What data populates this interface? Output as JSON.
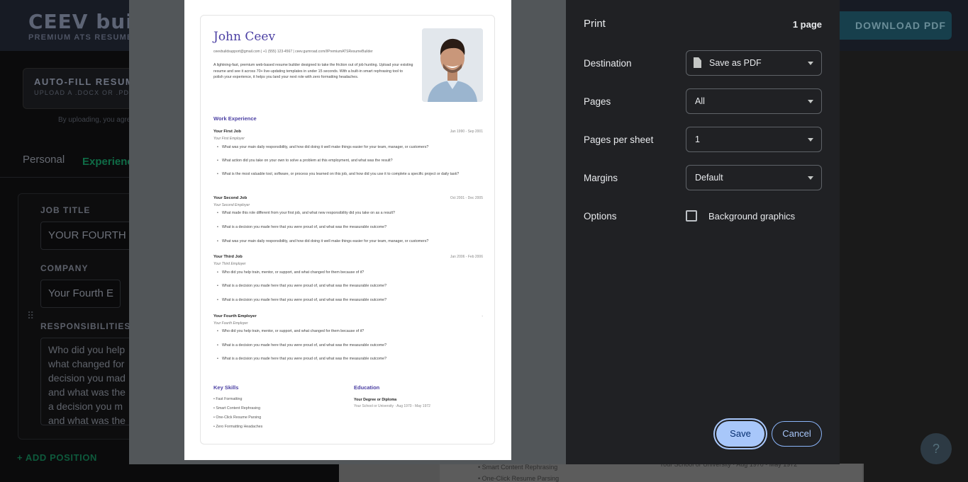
{
  "background_app": {
    "brand": "CEEV build",
    "brand_sub": "PREMIUM ATS RESUME",
    "download_button": "DOWNLOAD PDF",
    "autofill_title": "AUTO-FILL RESUME",
    "autofill_sub": "UPLOAD A .DOCX OR .PDF F",
    "consent_text": "By uploading, you agre",
    "tab_personal": "Personal",
    "tab_experience": "Experienc",
    "job_title_label": "JOB TITLE",
    "job_title_value": "YOUR FOURTH E",
    "company_label": "COMPANY",
    "company_value": "Your Fourth E",
    "responsibilities_label": "RESPONSIBILITIES",
    "responsibilities_value": "Who did you help what changed for decision you mad and what was the a decision you m and what was the",
    "add_position": "+ ADD POSITION",
    "behind_line1": "• Smart Content Rephrasing",
    "behind_line2": "• One-Click Resume Parsing",
    "behind_line3": "Your School or University · Aug 1970 - May 1972",
    "help_icon": "?"
  },
  "resume": {
    "name": "John Ceev",
    "contact": "ceevbuildsupport@gmail.com | +1 (555) 123-4567 | ceev.gumroad.com/l/PremiumATSResumeBuilder",
    "summary": "A lightning-fast, premium web-based resume builder designed to take the friction out of job hunting. Upload your existing resume and see it across 70+ live-updating templates in under 15 seconds. With a built-in smart rephrasing tool to polish your experience, it helps you land your next role with zero formatting headaches.",
    "work_heading": "Work Experience",
    "jobs": [
      {
        "title": "Your First Job",
        "date": "Jan 1990 - Sep 2001",
        "employer": "Your First Employer",
        "bullets": [
          "What was your main daily responsibility, and how did doing it well make things easier for your team, manager, or customers?",
          "What action did you take on your own to solve a problem at this employment, and what was the result?",
          "What is the most valuable tool, software, or process you learned on this job, and how did you use it to complete a specific project or daily task?"
        ]
      },
      {
        "title": "Your Second Job",
        "date": "Oct 2001 - Dec 2005",
        "employer": "Your Second Employer",
        "bullets": [
          "What made this role different from your first job, and what new responsibility did you take on as a result?",
          "What is a decision you made here that you were proud of, and what was the measurable outcome?",
          "What was your main daily responsibility, and how did doing it well make things easier for your team, manager, or customers?"
        ]
      },
      {
        "title": "Your Third Job",
        "date": "Jan 2006 - Feb 2006",
        "employer": "Your Third Employer",
        "bullets": [
          "Who did you help train, mentor, or support, and what changed for them because of it?",
          "What is a decision you made here that you were proud of, and what was the measurable outcome?",
          "What is a decision you made here that you were proud of, and what was the measurable outcome?"
        ]
      },
      {
        "title": "Your Fourth Employer",
        "date": "-",
        "employer": "Your Fourth Employer",
        "bullets": [
          "Who did you help train, mentor, or support, and what changed for them because of it?",
          "What is a decision you made here that you were proud of, and what was the measurable outcome?",
          "What is a decision you made here that you were proud of, and what was the measurable outcome?"
        ]
      }
    ],
    "skills_heading": "Key Skills",
    "skills": [
      "• Fast Formatting",
      "• Smart Content Rephrasing",
      "• One-Click Resume Parsing",
      "• Zero Formatting Headaches"
    ],
    "education_heading": "Education",
    "education_degree": "Your Degree or Diploma",
    "education_school": "Your School or University · Aug 1970 - May 1972"
  },
  "print": {
    "title": "Print",
    "page_count": "1 page",
    "destination_label": "Destination",
    "destination_value": "Save as PDF",
    "pages_label": "Pages",
    "pages_value": "All",
    "per_sheet_label": "Pages per sheet",
    "per_sheet_value": "1",
    "margins_label": "Margins",
    "margins_value": "Default",
    "options_label": "Options",
    "background_graphics_label": "Background graphics",
    "background_graphics_checked": false,
    "save_button": "Save",
    "cancel_button": "Cancel"
  },
  "colors": {
    "accent": "#a8c7fa",
    "resume_heading": "#4b3fa3",
    "panel_bg": "#202124"
  }
}
